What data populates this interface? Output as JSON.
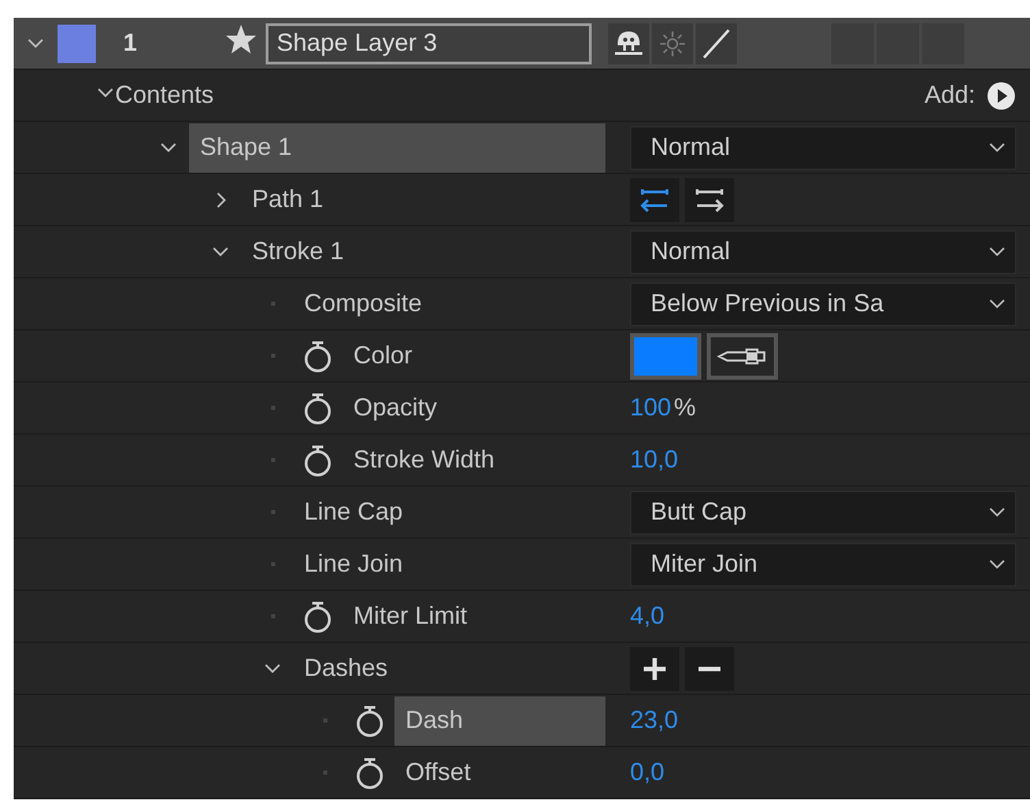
{
  "layer": {
    "expanded": true,
    "color": "#6b7fe0",
    "number": "1",
    "starred": true,
    "name": "Shape Layer 3",
    "switches": [
      {
        "kind": "shy",
        "on": true
      },
      {
        "kind": "quality",
        "on": false
      },
      {
        "kind": "slash",
        "on": true
      },
      {
        "kind": "blank"
      },
      {
        "kind": "blank"
      },
      {
        "kind": "blank"
      }
    ]
  },
  "contents": {
    "label": "Contents",
    "expanded": true,
    "add_label": "Add:",
    "children": [
      {
        "label": "Shape 1",
        "expanded": true,
        "selected": true,
        "control": {
          "kind": "dropdown",
          "value": "Normal"
        },
        "children": [
          {
            "label": "Path 1",
            "expanded": false,
            "selected": false,
            "control": {
              "kind": "direction",
              "buttons": [
                {
                  "selected": true
                },
                {
                  "selected": false
                }
              ]
            }
          },
          {
            "label": "Stroke 1",
            "expanded": true,
            "selected": false,
            "control": {
              "kind": "dropdown",
              "value": "Normal"
            },
            "children": [
              {
                "label": "Composite",
                "stopwatch": false,
                "selected": false,
                "control": {
                  "kind": "dropdown",
                  "value": "Below Previous in Sa"
                }
              },
              {
                "label": "Color",
                "stopwatch": true,
                "selected": false,
                "control": {
                  "kind": "color",
                  "color": "#0a7cff"
                }
              },
              {
                "label": "Opacity",
                "stopwatch": true,
                "selected": false,
                "control": {
                  "kind": "value",
                  "value": "100",
                  "unit": "%"
                }
              },
              {
                "label": "Stroke Width",
                "stopwatch": true,
                "selected": false,
                "control": {
                  "kind": "value",
                  "value": "10,0"
                }
              },
              {
                "label": "Line Cap",
                "stopwatch": false,
                "selected": false,
                "control": {
                  "kind": "dropdown",
                  "value": "Butt Cap"
                }
              },
              {
                "label": "Line Join",
                "stopwatch": false,
                "selected": false,
                "control": {
                  "kind": "dropdown",
                  "value": "Miter Join"
                }
              },
              {
                "label": "Miter Limit",
                "stopwatch": true,
                "selected": false,
                "control": {
                  "kind": "value",
                  "value": "4,0"
                }
              },
              {
                "label": "Dashes",
                "expanded": true,
                "selected": false,
                "control": {
                  "kind": "dashes"
                },
                "children": [
                  {
                    "label": "Dash",
                    "stopwatch": true,
                    "selected": true,
                    "control": {
                      "kind": "value",
                      "value": "23,0"
                    }
                  },
                  {
                    "label": "Offset",
                    "stopwatch": true,
                    "selected": false,
                    "control": {
                      "kind": "value",
                      "value": "0,0"
                    }
                  }
                ]
              }
            ]
          }
        ]
      }
    ]
  }
}
